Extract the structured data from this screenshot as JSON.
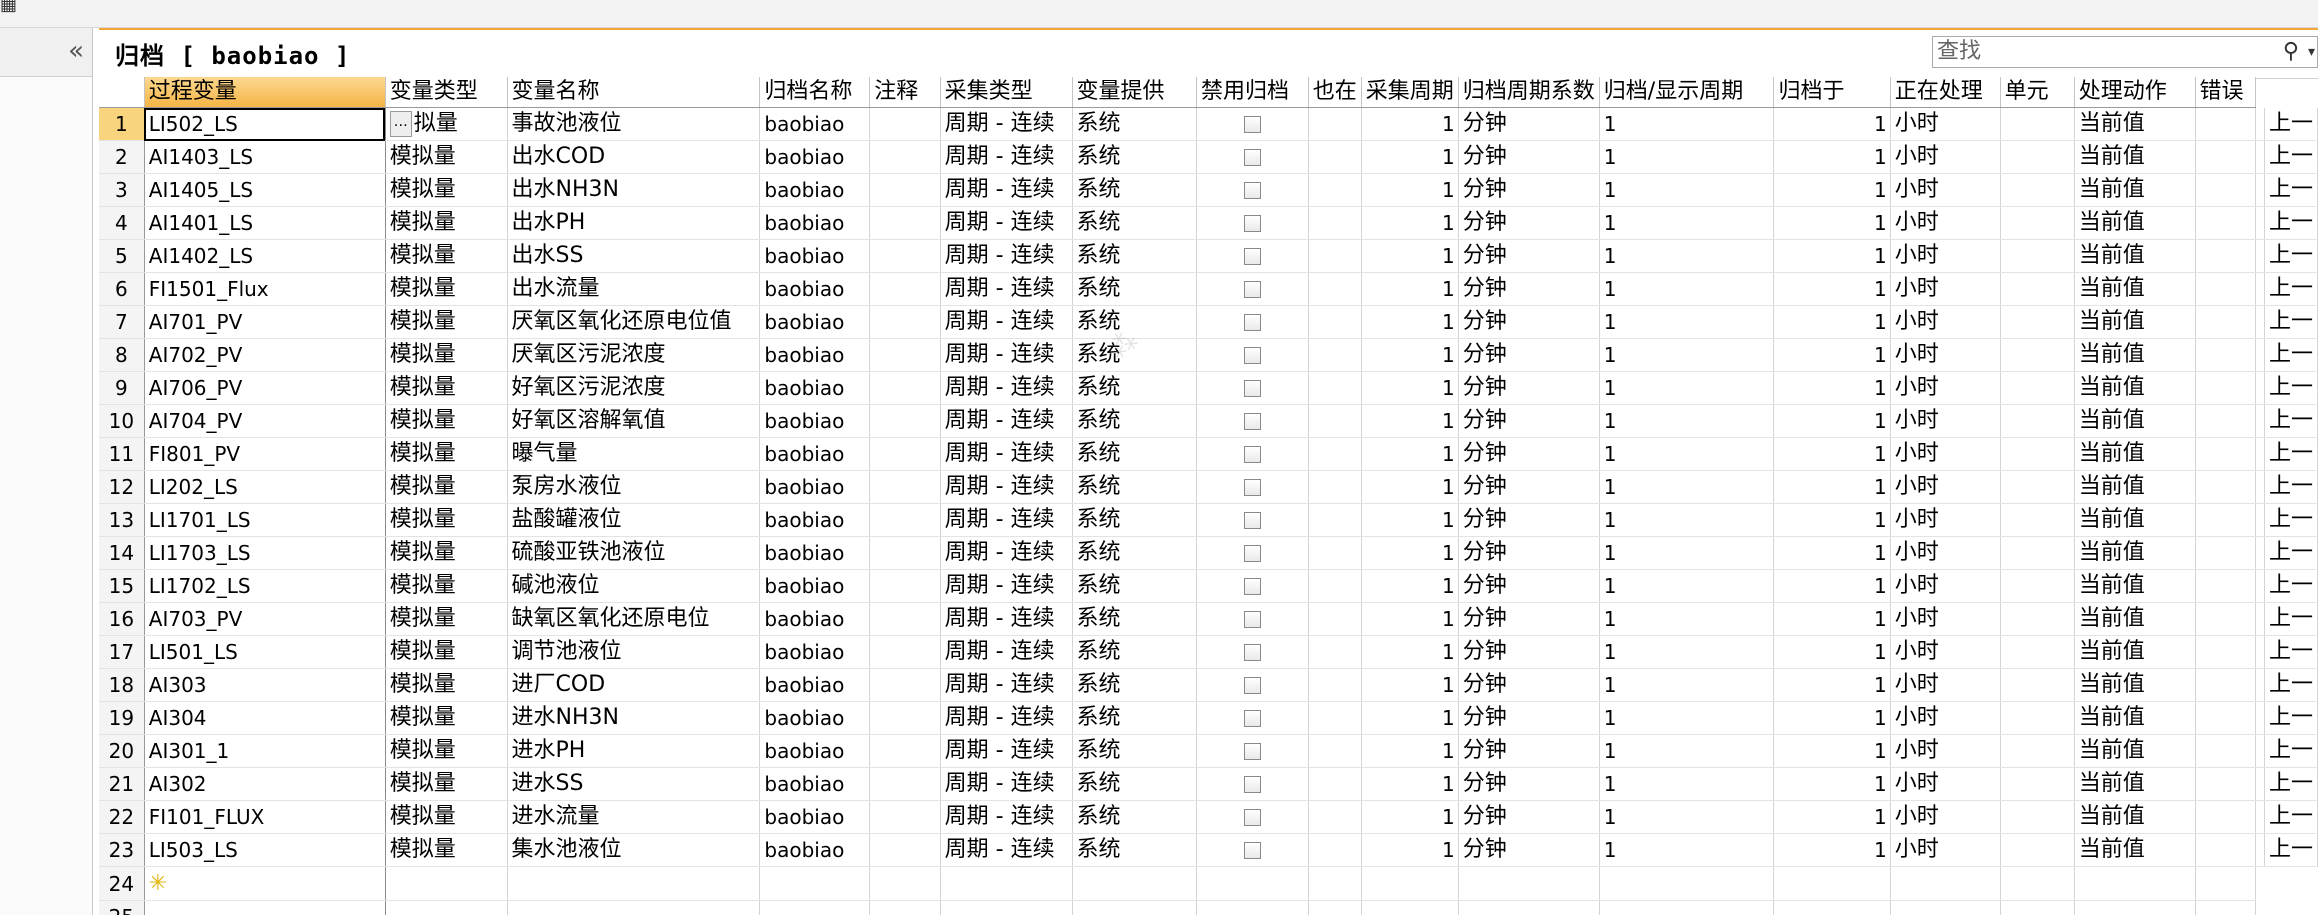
{
  "top": {
    "icon": "grid-icon"
  },
  "nav": {
    "collapse": "«"
  },
  "panel": {
    "title": "归档 [ baobiao ]"
  },
  "search": {
    "placeholder": "查找",
    "icon": "⚲",
    "dropdown": "▾"
  },
  "columns": [
    "过程变量",
    "变量类型",
    "变量名称",
    "归档名称",
    "注释",
    "采集类型",
    "变量提供",
    "禁用归档",
    "也在",
    "采集周期",
    "归档周期系数",
    "归档/显示周期",
    "归档于",
    "正在处理",
    "单元",
    "处理动作",
    "错误"
  ],
  "rows": [
    {
      "n": "1",
      "pv": "LI502_LS",
      "type": "拟量",
      "name": "事故池液位"
    },
    {
      "n": "2",
      "pv": "AI1403_LS",
      "type": "模拟量",
      "name": "出水COD"
    },
    {
      "n": "3",
      "pv": "AI1405_LS",
      "type": "模拟量",
      "name": "出水NH3N"
    },
    {
      "n": "4",
      "pv": "AI1401_LS",
      "type": "模拟量",
      "name": "出水PH"
    },
    {
      "n": "5",
      "pv": "AI1402_LS",
      "type": "模拟量",
      "name": "出水SS"
    },
    {
      "n": "6",
      "pv": "FI1501_Flux",
      "type": "模拟量",
      "name": "出水流量"
    },
    {
      "n": "7",
      "pv": "AI701_PV",
      "type": "模拟量",
      "name": "厌氧区氧化还原电位值"
    },
    {
      "n": "8",
      "pv": "AI702_PV",
      "type": "模拟量",
      "name": "厌氧区污泥浓度"
    },
    {
      "n": "9",
      "pv": "AI706_PV",
      "type": "模拟量",
      "name": "好氧区污泥浓度"
    },
    {
      "n": "10",
      "pv": "AI704_PV",
      "type": "模拟量",
      "name": "好氧区溶解氧值"
    },
    {
      "n": "11",
      "pv": "FI801_PV",
      "type": "模拟量",
      "name": "曝气量"
    },
    {
      "n": "12",
      "pv": "LI202_LS",
      "type": "模拟量",
      "name": "泵房水液位"
    },
    {
      "n": "13",
      "pv": "LI1701_LS",
      "type": "模拟量",
      "name": "盐酸罐液位"
    },
    {
      "n": "14",
      "pv": "LI1703_LS",
      "type": "模拟量",
      "name": "硫酸亚铁池液位"
    },
    {
      "n": "15",
      "pv": "LI1702_LS",
      "type": "模拟量",
      "name": "碱池液位"
    },
    {
      "n": "16",
      "pv": "AI703_PV",
      "type": "模拟量",
      "name": "缺氧区氧化还原电位"
    },
    {
      "n": "17",
      "pv": "LI501_LS",
      "type": "模拟量",
      "name": "调节池液位"
    },
    {
      "n": "18",
      "pv": "AI303",
      "type": "模拟量",
      "name": "进厂COD"
    },
    {
      "n": "19",
      "pv": "AI304",
      "type": "模拟量",
      "name": "进水NH3N"
    },
    {
      "n": "20",
      "pv": "AI301_1",
      "type": "模拟量",
      "name": "进水PH"
    },
    {
      "n": "21",
      "pv": "AI302",
      "type": "模拟量",
      "name": "进水SS"
    },
    {
      "n": "22",
      "pv": "FI101_FLUX",
      "type": "模拟量",
      "name": "进水流量"
    },
    {
      "n": "23",
      "pv": "LI503_LS",
      "type": "模拟量",
      "name": "集水池液位"
    }
  ],
  "common": {
    "archive": "baobiao",
    "acq_type": "周期 - 连续",
    "provider": "系统",
    "acq_num": "1",
    "acq_unit": "分钟",
    "factor": "1",
    "disp_num": "1",
    "disp_unit": "小时",
    "processing": "当前值",
    "error": "上一"
  },
  "extra_rows": [
    {
      "n": "24",
      "mark": "✳"
    },
    {
      "n": "25",
      "mark": ""
    }
  ]
}
